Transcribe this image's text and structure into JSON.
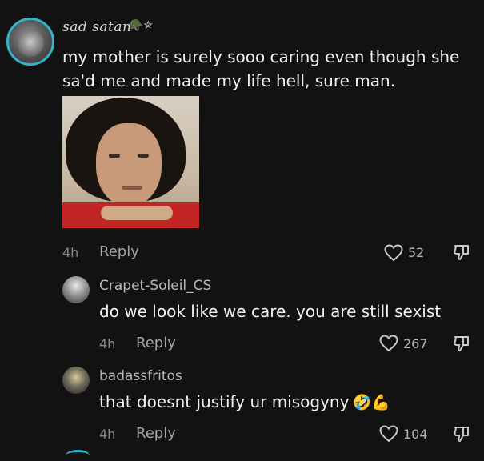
{
  "main_comment": {
    "username": "sad satan",
    "badges": "🪖✮",
    "text": "my mother is surely sooo caring even though she sa'd me and made my life hell, sure man.",
    "time": "4h",
    "reply_label": "Reply",
    "likes": "52"
  },
  "replies": [
    {
      "username": "Crapet-Soleil_CS",
      "text": "do we look like we care. you are still sexist",
      "emoji": "",
      "time": "4h",
      "reply_label": "Reply",
      "likes": "267"
    },
    {
      "username": "badassfritos",
      "text": "that doesnt justify ur misogyny",
      "emoji": "🤣💪",
      "time": "4h",
      "reply_label": "Reply",
      "likes": "104"
    }
  ],
  "colors": {
    "background": "#121212",
    "avatar_ring": "#2fb4c9",
    "secondary_text": "#a6a6a6"
  },
  "icons": {
    "like": "heart-outline-icon",
    "dislike": "thumbs-down-outline-icon"
  }
}
